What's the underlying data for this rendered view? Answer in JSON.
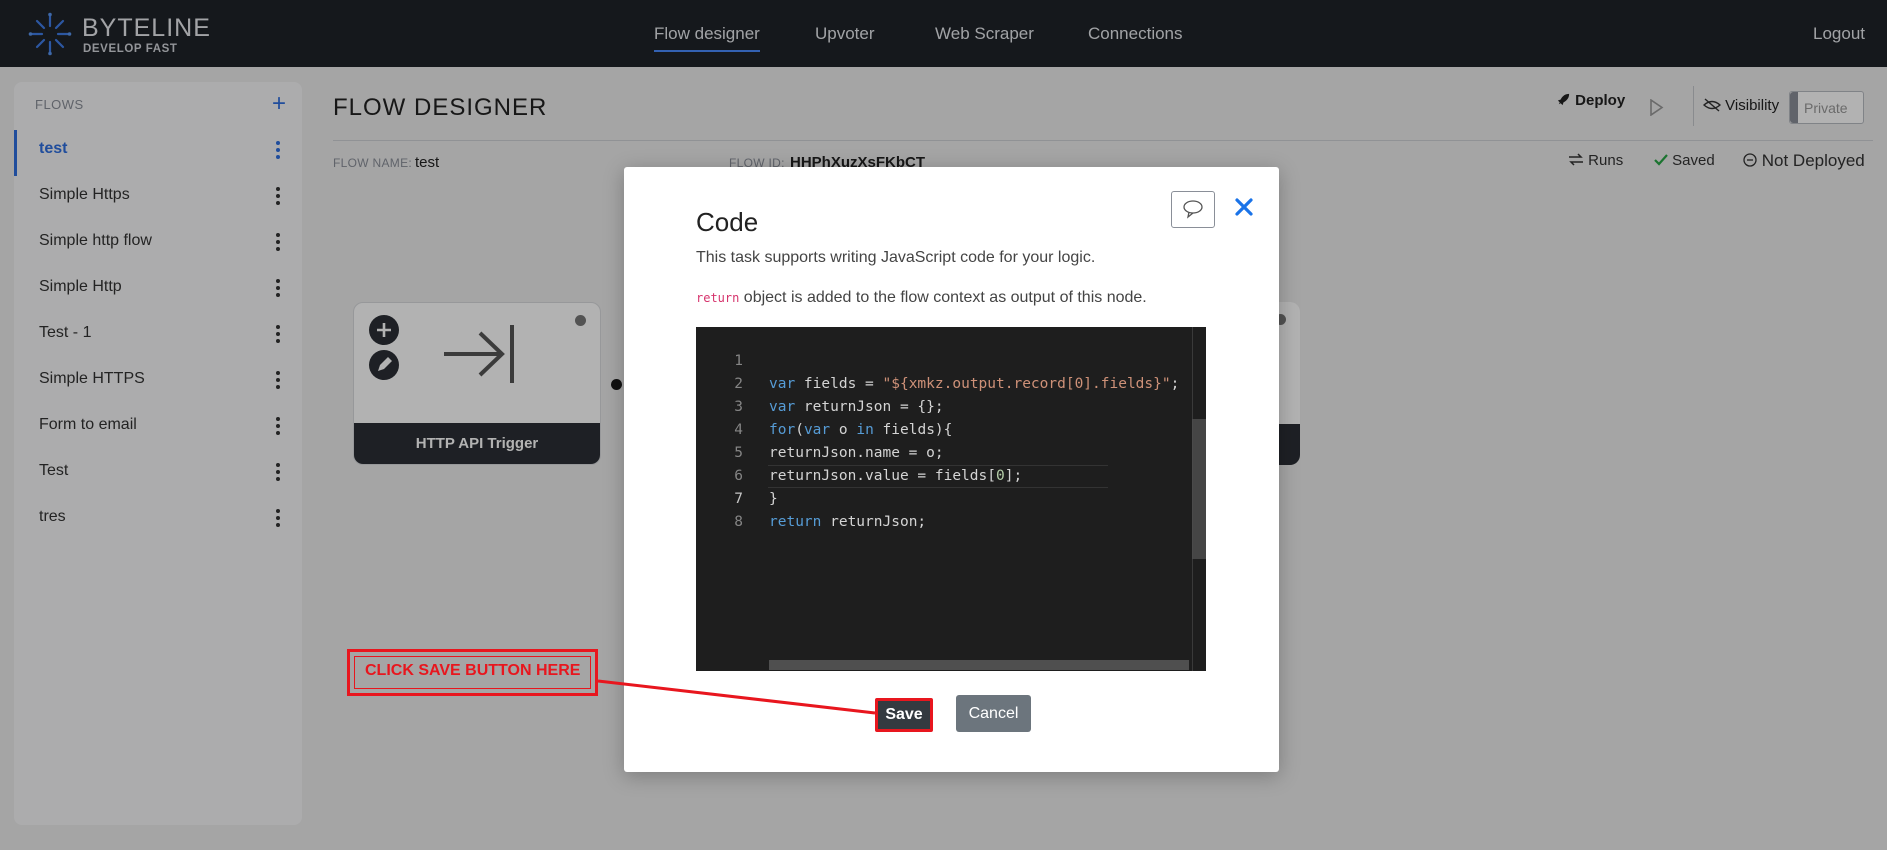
{
  "app": {
    "logo_title": "BYTELINE",
    "logo_sub": "DEVELOP FAST",
    "accent": "#2f6fe0"
  },
  "nav": {
    "items": [
      "Flow designer",
      "Upvoter",
      "Web Scraper",
      "Connections"
    ],
    "active": "Flow designer",
    "logout": "Logout"
  },
  "sidebar": {
    "header": "FLOWS",
    "add": "+",
    "items": [
      "test",
      "Simple Https",
      "Simple http flow",
      "Simple Http",
      "Test - 1",
      "Simple HTTPS",
      "Form to email",
      "Test",
      "tres"
    ],
    "active": "test"
  },
  "main": {
    "title": "FLOW DESIGNER",
    "deploy": "Deploy",
    "visibility": "Visibility",
    "private": "Private",
    "flow_name_label": "FLOW NAME:",
    "flow_name": "test",
    "flow_id_label": "FLOW ID:",
    "flow_id": "HHPhXuzXsFKbCT",
    "runs": "Runs",
    "saved": "Saved",
    "not_deployed": "Not Deployed"
  },
  "canvas": {
    "node_label": "HTTP API Trigger"
  },
  "modal": {
    "title": "Code",
    "desc": "This task supports writing JavaScript code for your logic.",
    "desc2_code": "return",
    "desc2_text": " object is added to the flow context as output of this node.",
    "save": "Save",
    "cancel": "Cancel",
    "code_lines": [
      "var fields = \"${xmkz.output.record[0].fields}\";",
      "var returnJson = {};",
      "for(var o in fields){",
      "returnJson.name = o;",
      "returnJson.value = fields[0];",
      "}",
      "return returnJson;",
      ""
    ],
    "current_line": 7
  },
  "annotation": {
    "text": "CLICK SAVE BUTTON HERE",
    "color": "#e8161e"
  }
}
